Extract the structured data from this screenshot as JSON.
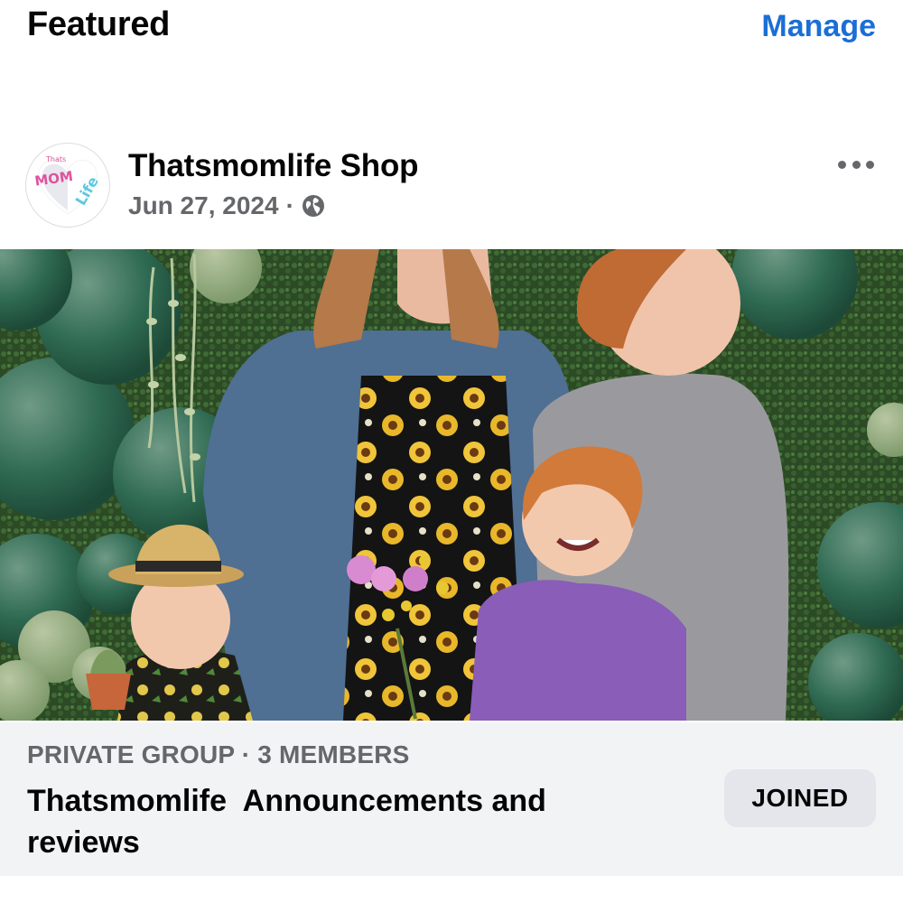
{
  "header": {
    "title": "Featured",
    "manage_label": "Manage"
  },
  "post": {
    "author": "Thatsmomlife Shop",
    "date": "Jun 27, 2024",
    "separator": "·",
    "visibility_icon": "globe-icon",
    "more_icon": "more-options-icon",
    "avatar": {
      "logo_text_top": "Thats",
      "logo_text_mom": "MOM",
      "logo_text_life": "Life"
    }
  },
  "group": {
    "meta": "PRIVATE GROUP · 3 MEMBERS",
    "name": "Thatsmomlife  Announcements and reviews",
    "joined_label": "JOINED"
  },
  "colors": {
    "accent": "#1b6ed6",
    "secondary_text": "#65676b",
    "footer_bg": "#f2f3f5",
    "button_bg": "#e4e6eb"
  }
}
